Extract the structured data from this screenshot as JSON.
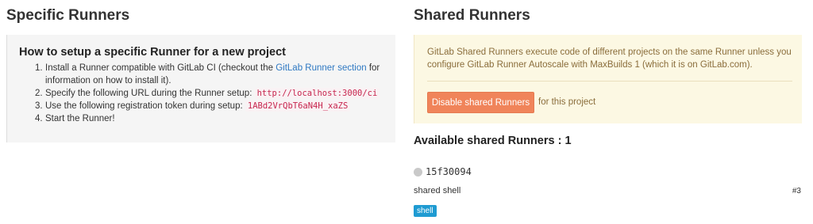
{
  "specific": {
    "title": "Specific Runners",
    "setup_title": "How to setup a specific Runner for a new project",
    "step1_pre": "Install a Runner compatible with GitLab CI (checkout the ",
    "step1_link": "GitLab Runner section",
    "step1_post": " for",
    "step1_cont": "information on how to install it).",
    "step2_text": "Specify the following URL during the Runner setup: ",
    "step2_url": "http://localhost:3000/ci",
    "step3_text": "Use the following registration token during setup: ",
    "step3_token": "1ABd2VrQbT6aN4H_xaZS",
    "step4_text": "Start the Runner!",
    "nums": [
      "1.",
      "2.",
      "3.",
      "4."
    ]
  },
  "shared": {
    "title": "Shared Runners",
    "info_line1": "GitLab Shared Runners execute code of different projects on the same Runner unless you",
    "info_line2": "configure GitLab Runner Autoscale with MaxBuilds 1 (which it is on GitLab.com).",
    "disable_button": "Disable shared Runners",
    "button_suffix": "for this project",
    "available_title": "Available shared Runners : 1",
    "runner": {
      "token": "15f30094",
      "description": "shared shell",
      "id": "#3",
      "tag": "shell",
      "status_color": "#c9c9c9"
    }
  },
  "colors": {
    "accent_orange": "#f0845a",
    "link_blue": "#2e78c2",
    "code_red": "#c7254e",
    "warning_text": "#8a6d3b",
    "tag_blue": "#1f9bd2"
  }
}
